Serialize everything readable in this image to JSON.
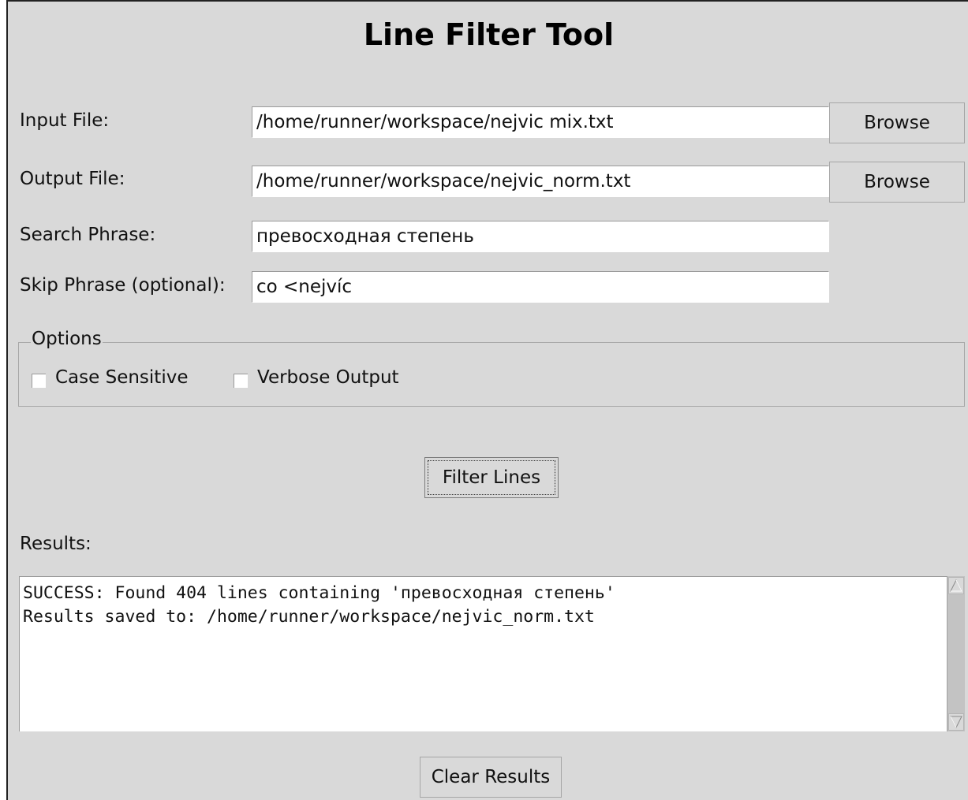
{
  "app": {
    "title": "Line Filter Tool"
  },
  "form": {
    "input_file": {
      "label": "Input File:",
      "value": "/home/runner/workspace/nejvic mix.txt",
      "button_label": "Browse"
    },
    "output_file": {
      "label": "Output File:",
      "value": "/home/runner/workspace/nejvic_norm.txt",
      "button_label": "Browse"
    },
    "search_phrase": {
      "label": "Search Phrase:",
      "value": "превосходная степень"
    },
    "skip_phrase": {
      "label": "Skip Phrase (optional):",
      "value": "co <nejvíc"
    }
  },
  "options": {
    "legend": "Options",
    "case_sensitive": {
      "label": "Case Sensitive",
      "checked": false
    },
    "verbose_output": {
      "label": "Verbose Output",
      "checked": false
    }
  },
  "actions": {
    "filter_label": "Filter Lines",
    "clear_label": "Clear Results"
  },
  "results": {
    "label": "Results:",
    "lines": [
      "SUCCESS: Found 404 lines containing 'превосходная степень'",
      "Results saved to: /home/runner/workspace/nejvic_norm.txt"
    ]
  }
}
